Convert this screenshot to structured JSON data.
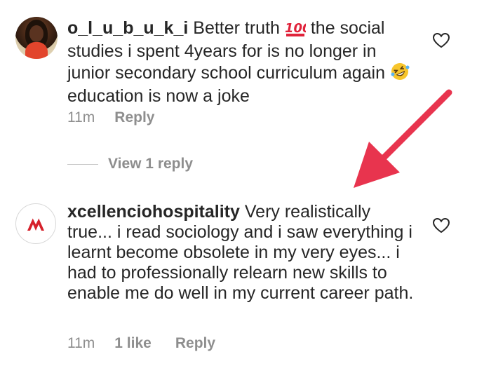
{
  "comments": [
    {
      "username": "o_l_u_b_u_k_i",
      "text_part1": "Better truth",
      "text_part2": " the social studies i spent 4years for is no longer in junior secondary school curriculum again",
      "text_part3": " education is now a joke",
      "emoji_1": "hundred-points-emoji",
      "emoji_2": "rolling-laughing-emoji",
      "time": "11m",
      "reply_label": "Reply"
    },
    {
      "username": "xcellenciohospitality",
      "text": " Very realistically true... i read sociology and i saw everything i learnt become obsolete in my very eyes... i had to professionally relearn new skills to enable me do well in my current career path.",
      "time": "11m",
      "likes": "1 like",
      "reply_label": "Reply"
    }
  ],
  "view_replies_label": "View 1 reply",
  "colors": {
    "text": "#262626",
    "meta": "#8e8e8e",
    "arrow": "#e8344e",
    "logo": "#d6212b"
  },
  "icons": [
    "heart-outline-icon",
    "red-arrow-annotation"
  ]
}
